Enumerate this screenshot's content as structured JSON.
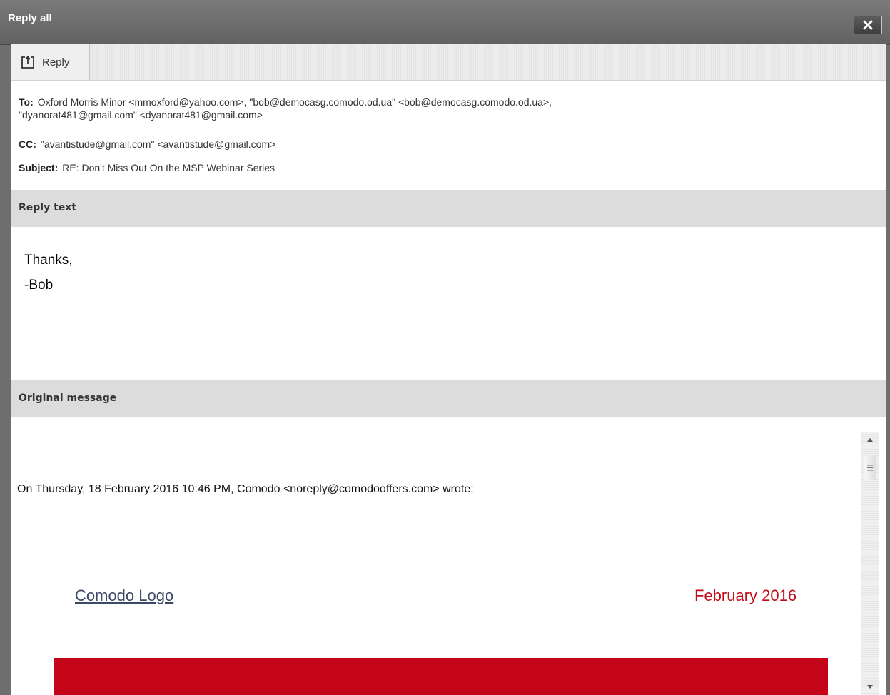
{
  "window": {
    "title": "Reply all"
  },
  "toolbar": {
    "reply_label": "Reply"
  },
  "headers": {
    "to_label": "To:",
    "to_line1": "Oxford Morris Minor <mmoxford@yahoo.com>, \"bob@democasg.comodo.od.ua\" <bob@democasg.comodo.od.ua>,",
    "to_line2": "\"dyanorat481@gmail.com\" <dyanorat481@gmail.com>",
    "cc_label": "CC:",
    "cc_value": "\"avantistude@gmail.com\" <avantistude@gmail.com>",
    "subject_label": "Subject:",
    "subject_value": "RE: Don't Miss Out On the MSP Webinar Series"
  },
  "sections": {
    "reply_text": "Reply text",
    "original_message": "Original message"
  },
  "reply": {
    "line1": "Thanks,",
    "line2": "-Bob"
  },
  "original": {
    "wrote_line": "On Thursday, 18 February 2016 10:46 PM, Comodo <noreply@comodooffers.com> wrote:",
    "logo_link": "Comodo Logo",
    "month": "February 2016"
  },
  "colors": {
    "brand_red": "#c40418",
    "month_red": "#c40c17",
    "section_bar": "#dcdcdc",
    "titlebar": "#6e6e6e"
  },
  "icons": {
    "close": "close-icon",
    "reply": "reply-icon",
    "scroll_up": "arrow-up-icon",
    "scroll_down": "arrow-down-icon",
    "grip": "grip-icon"
  }
}
